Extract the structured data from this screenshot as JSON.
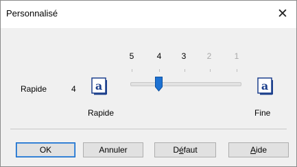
{
  "window": {
    "title": "Personnalisé"
  },
  "slider": {
    "label": "Rapide",
    "current_value": "4",
    "scale_labels": [
      "5",
      "4",
      "3",
      "2",
      "1"
    ],
    "left_caption": "Rapide",
    "right_caption": "Fine",
    "icon_glyph": "a",
    "position_fraction": 0.25
  },
  "buttons": {
    "ok": "OK",
    "cancel": "Annuler",
    "default_pre": "D",
    "default_accel": "é",
    "default_post": "faut",
    "help_pre": "",
    "help_accel": "A",
    "help_post": "ide"
  },
  "colors": {
    "accent": "#1e72d2",
    "icon_border": "#1c3f8c"
  }
}
